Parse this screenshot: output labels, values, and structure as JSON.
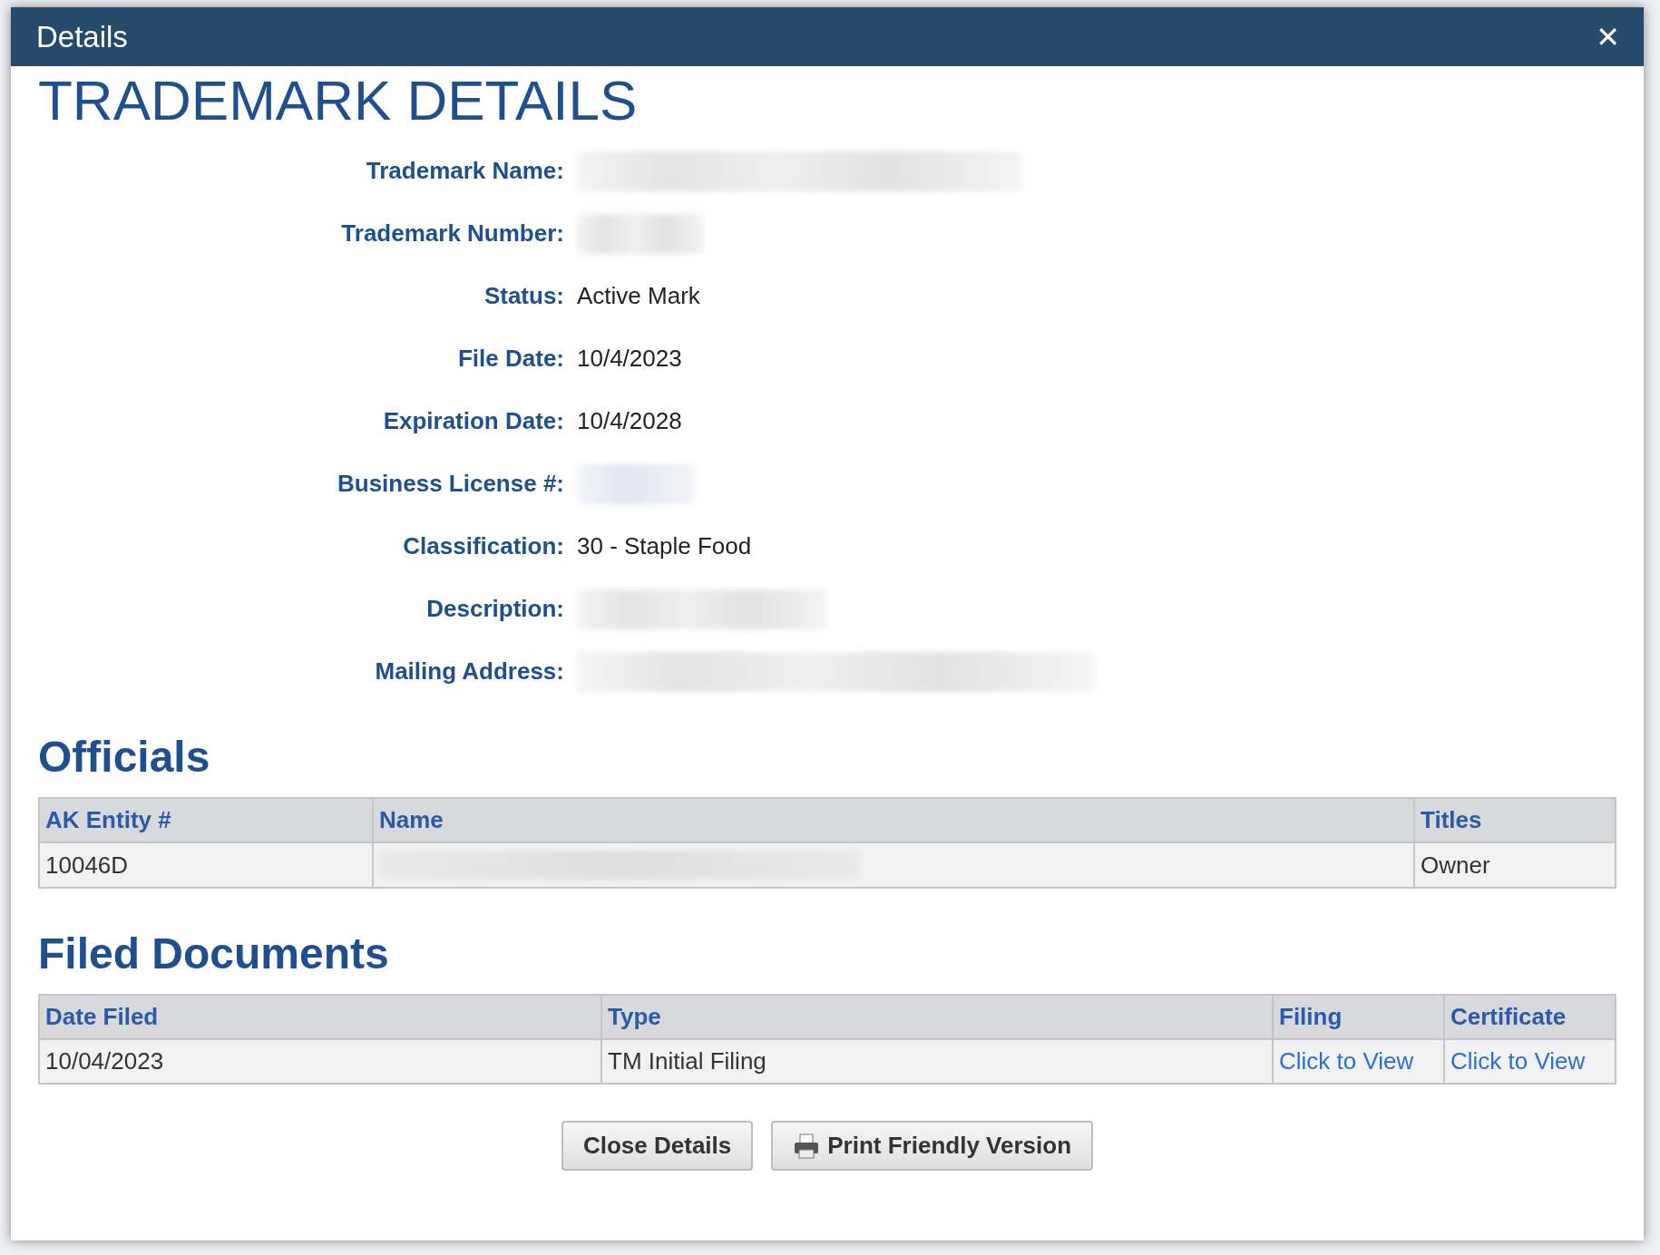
{
  "dialog": {
    "title": "Details",
    "close_icon": "✕"
  },
  "heading": "TRADEMARK DETAILS",
  "fields": [
    {
      "label": "Trademark Name:",
      "kind": "redacted"
    },
    {
      "label": "Trademark Number:",
      "kind": "redacted"
    },
    {
      "label": "Status:",
      "kind": "text",
      "value": "Active Mark"
    },
    {
      "label": "File Date:",
      "kind": "text",
      "value": "10/4/2023"
    },
    {
      "label": "Expiration Date:",
      "kind": "text",
      "value": "10/4/2028"
    },
    {
      "label": "Business License #:",
      "kind": "redacted_link"
    },
    {
      "label": "Classification:",
      "kind": "text",
      "value": "30 - Staple Food"
    },
    {
      "label": "Description:",
      "kind": "redacted"
    },
    {
      "label": "Mailing Address:",
      "kind": "redacted"
    }
  ],
  "officials": {
    "title": "Officials",
    "columns": [
      "AK Entity #",
      "Name",
      "Titles"
    ],
    "rows": [
      [
        {
          "kind": "text",
          "text": "10046D"
        },
        {
          "kind": "redacted"
        },
        {
          "kind": "text",
          "text": "Owner"
        }
      ]
    ]
  },
  "filed_documents": {
    "title": "Filed Documents",
    "columns": [
      "Date Filed",
      "Type",
      "Filing",
      "Certificate"
    ],
    "rows": [
      [
        {
          "kind": "text",
          "text": "10/04/2023"
        },
        {
          "kind": "text",
          "text": "TM Initial Filing"
        },
        {
          "kind": "link",
          "text": "Click to View"
        },
        {
          "kind": "link",
          "text": "Click to View"
        }
      ]
    ]
  },
  "buttons": [
    {
      "label": "Close Details",
      "kind": "plain"
    },
    {
      "label": "Print Friendly Version",
      "kind": "print"
    }
  ]
}
